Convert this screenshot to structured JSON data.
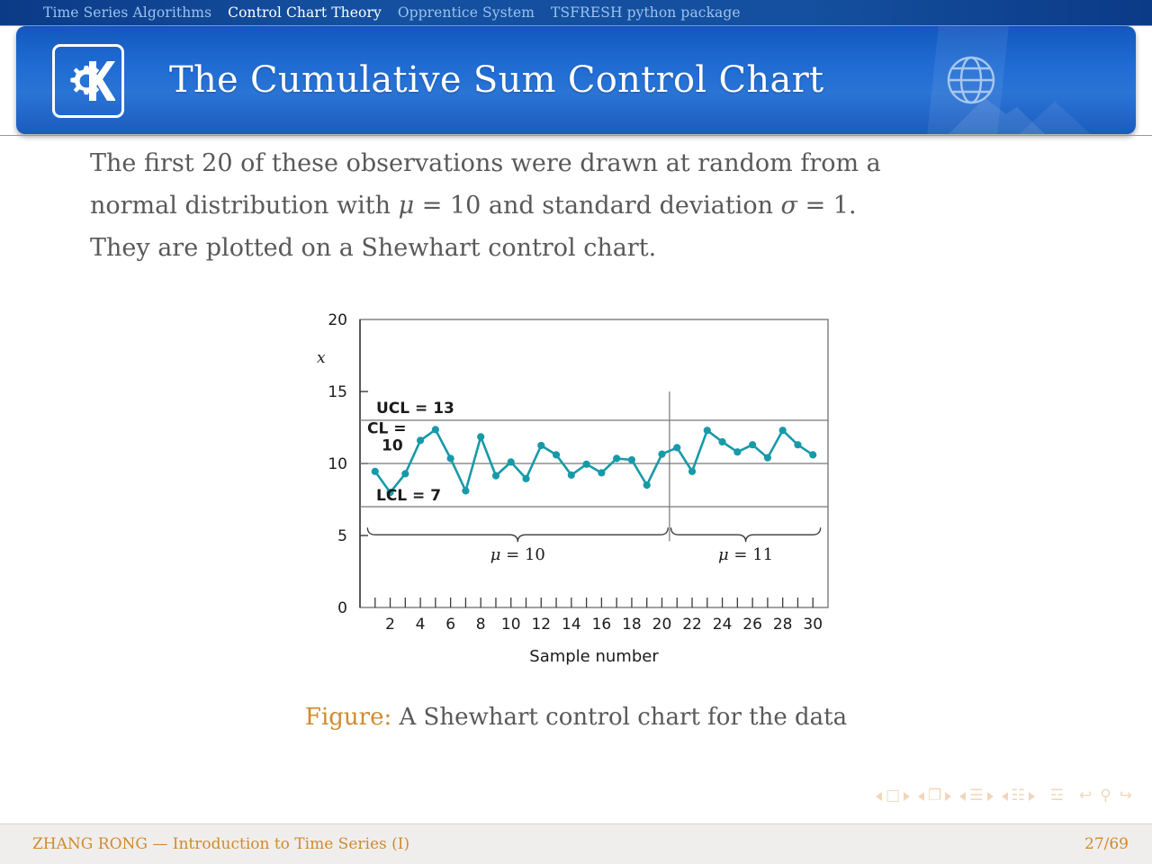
{
  "nav": {
    "items": [
      {
        "label": "Time Series Algorithms",
        "active": false
      },
      {
        "label": "Control Chart Theory",
        "active": true
      },
      {
        "label": "Opprentice System",
        "active": false
      },
      {
        "label": "TSFRESH python package",
        "active": false
      }
    ]
  },
  "header": {
    "title": "The Cumulative Sum Control Chart",
    "logo_icon": "kde-gear-k-logo-icon",
    "globe_icon": "globe-icon",
    "background_color": "#1f6bd2"
  },
  "body": {
    "line1_a": "The first 20 of these observations were drawn at random from a",
    "line2_a": "normal distribution with ",
    "line2_mu": "μ",
    "line2_b": " = 10 and standard deviation ",
    "line2_sigma": "σ",
    "line2_c": " = 1.",
    "line3": "They are plotted on a Shewhart control chart."
  },
  "caption": {
    "label": "Figure",
    "separator": ":",
    "text": " A Shewhart control chart for the data",
    "label_color": "#d08a2e"
  },
  "nav_symbols": {
    "groups": [
      {
        "name": "slide-nav",
        "glyph": "□"
      },
      {
        "name": "frame-nav",
        "glyph": "❐"
      },
      {
        "name": "subsection-nav",
        "glyph": "☰"
      },
      {
        "name": "section-nav",
        "glyph": "☷"
      }
    ],
    "doc_glyph": "☲",
    "back_glyph": "↩",
    "search_glyph": "⚲",
    "forward_glyph": "↪"
  },
  "footer": {
    "left": "ZHANG RONG — Introduction to Time Series (I)",
    "right": "27/69",
    "color": "#d08a2e"
  },
  "chart_data": {
    "type": "line",
    "title": "",
    "xlabel": "Sample number",
    "ylabel": "x",
    "xlim": [
      0,
      31
    ],
    "ylim": [
      0,
      20
    ],
    "yticks": [
      0,
      5,
      10,
      15,
      20
    ],
    "ytick_labels": [
      "0",
      "5",
      "10",
      "15",
      "20"
    ],
    "xticks": [
      2,
      4,
      6,
      8,
      10,
      12,
      14,
      16,
      18,
      20,
      22,
      24,
      26,
      28,
      30
    ],
    "xtick_labels": [
      "2",
      "4",
      "6",
      "8",
      "10",
      "12",
      "14",
      "16",
      "18",
      "20",
      "22",
      "24",
      "26",
      "28",
      "30"
    ],
    "minor_xticks": [
      1,
      2,
      3,
      4,
      5,
      6,
      7,
      8,
      9,
      10,
      11,
      12,
      13,
      14,
      15,
      16,
      17,
      18,
      19,
      20,
      21,
      22,
      23,
      24,
      25,
      26,
      27,
      28,
      29,
      30
    ],
    "grid": false,
    "line_color": "#179aa8",
    "marker": "circle",
    "legend": "none",
    "x": [
      1,
      2,
      3,
      4,
      5,
      6,
      7,
      8,
      9,
      10,
      11,
      12,
      13,
      14,
      15,
      16,
      17,
      18,
      19,
      20,
      21,
      22,
      23,
      24,
      25,
      26,
      27,
      28,
      29,
      30
    ],
    "values": [
      9.45,
      7.99,
      9.29,
      11.6,
      12.35,
      10.35,
      8.1,
      11.85,
      9.15,
      10.1,
      8.95,
      11.25,
      10.6,
      9.2,
      9.95,
      9.35,
      10.35,
      10.25,
      8.5,
      10.65,
      11.1,
      9.45,
      12.3,
      11.5,
      10.8,
      11.3,
      10.4,
      12.3,
      11.3,
      10.6
    ],
    "control_lines": [
      {
        "name": "UCL",
        "label": "UCL = 13",
        "value": 13
      },
      {
        "name": "CL",
        "label": "CL =\n10",
        "value": 10
      },
      {
        "name": "LCL",
        "label": "LCL = 7",
        "value": 7
      }
    ],
    "ucl_label": "UCL = 13",
    "cl_label_line1": "CL =",
    "cl_label_line2": "10",
    "lcl_label": "LCL = 7",
    "shift_line_x": 20.5,
    "annotations": [
      {
        "name": "brace-mu-10",
        "label": "μ = 10",
        "x_start": 0.5,
        "x_end": 20.4
      },
      {
        "name": "brace-mu-11",
        "label": "μ = 11",
        "x_start": 20.6,
        "x_end": 30.5
      }
    ],
    "brace1_mu": "μ",
    "brace1_val": " = 10",
    "brace2_mu": "μ",
    "brace2_val": " = 11"
  }
}
